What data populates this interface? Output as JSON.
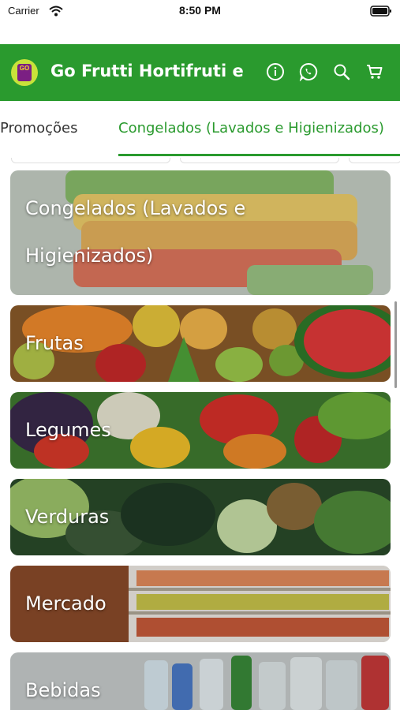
{
  "status_bar": {
    "carrier": "Carrier",
    "time": "8:50 PM"
  },
  "header": {
    "title": "Go Frutti Hortifruti e",
    "logo_text": "GO",
    "icons": [
      "info-icon",
      "whatsapp-icon",
      "search-icon",
      "cart-icon"
    ],
    "color": "#2a9a2e"
  },
  "tabs": [
    {
      "label": "Promoções",
      "active": false
    },
    {
      "label": "Congelados (Lavados e Higienizados)",
      "active": true
    }
  ],
  "categories": [
    {
      "label_line1": "Congelados (Lavados e",
      "label_line2": "Higienizados)"
    },
    {
      "label": "Frutas"
    },
    {
      "label": "Legumes"
    },
    {
      "label": "Verduras"
    },
    {
      "label": "Mercado"
    },
    {
      "label": "Bebidas"
    }
  ],
  "colors": {
    "accent": "#2a9a2e",
    "header_text": "#ffffff"
  }
}
